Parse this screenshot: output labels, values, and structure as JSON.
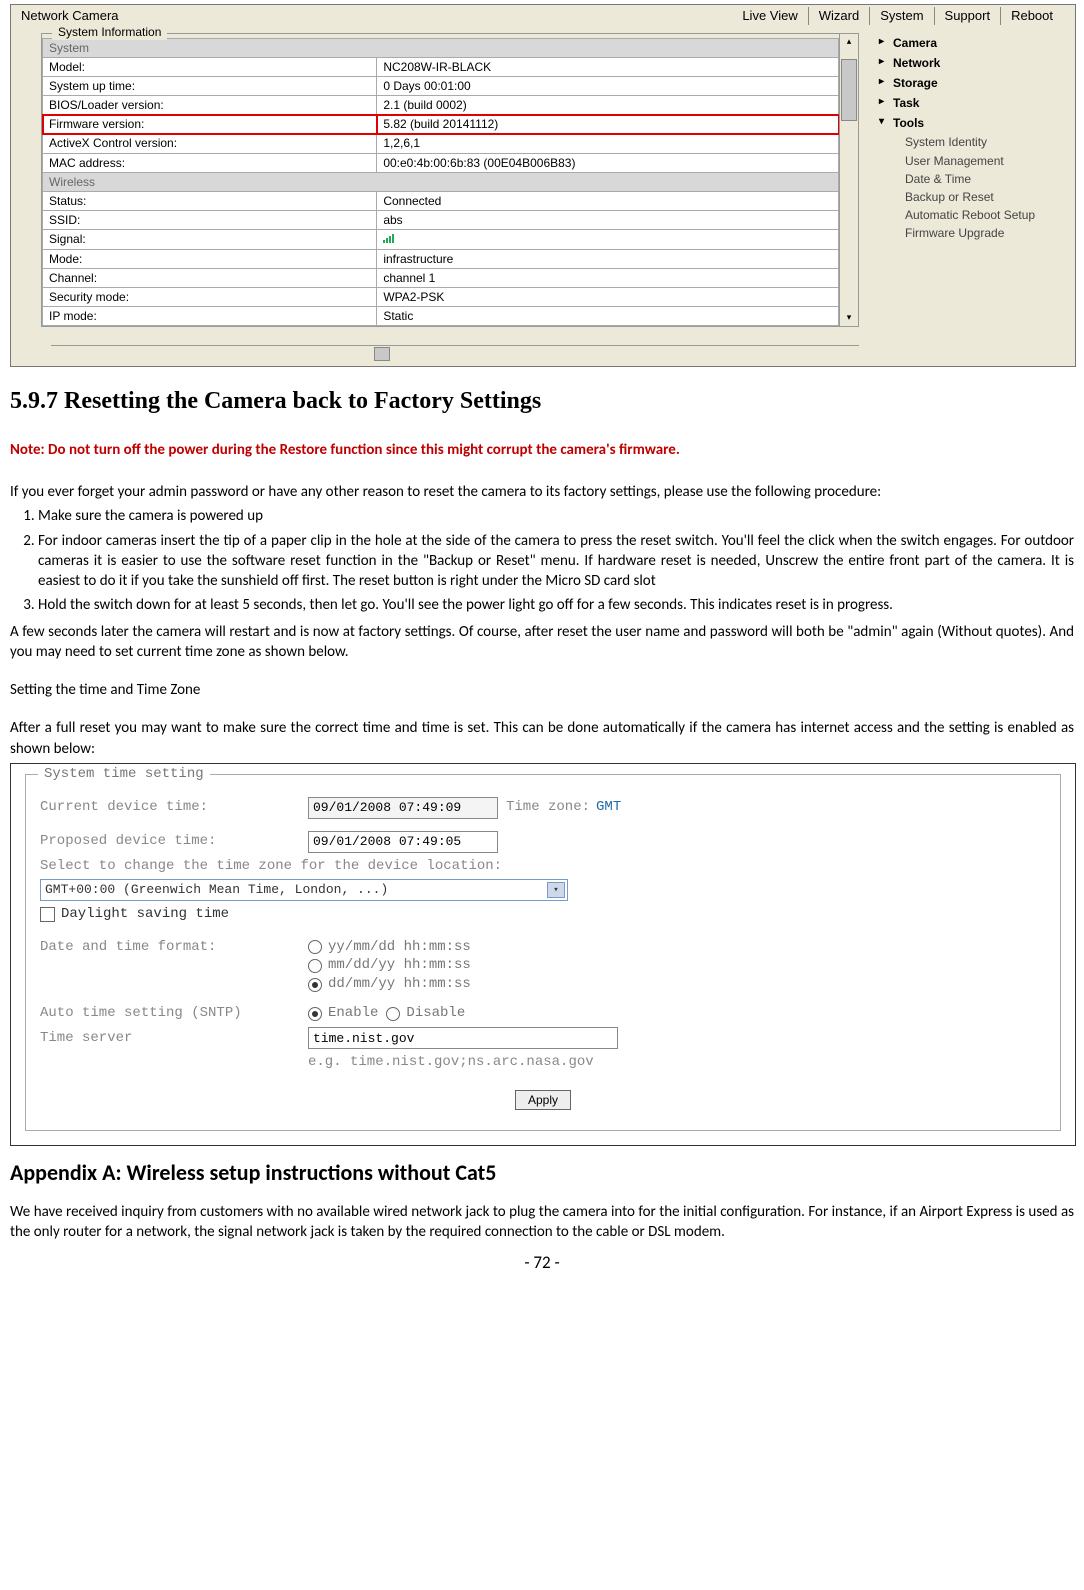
{
  "ss1": {
    "title": "Network Camera",
    "nav": [
      "Live View",
      "Wizard",
      "System",
      "Support",
      "Reboot"
    ],
    "panel_title": "System Information",
    "system_hdr": "System",
    "wireless_hdr": "Wireless",
    "rows_system": [
      {
        "k": "Model:",
        "v": "NC208W-IR-BLACK"
      },
      {
        "k": "System up time:",
        "v": "0 Days 00:01:00"
      },
      {
        "k": "BIOS/Loader version:",
        "v": "2.1 (build 0002)"
      },
      {
        "k": "Firmware version:",
        "v": "5.82 (build 20141112)",
        "hl": true
      },
      {
        "k": "ActiveX Control version:",
        "v": "1,2,6,1"
      },
      {
        "k": "MAC address:",
        "v": "00:e0:4b:00:6b:83 (00E04B006B83)"
      }
    ],
    "rows_wireless": [
      {
        "k": "Status:",
        "v": "Connected"
      },
      {
        "k": "SSID:",
        "v": "abs"
      },
      {
        "k": "Signal:",
        "v": "__SIGNAL__"
      },
      {
        "k": "Mode:",
        "v": "infrastructure"
      },
      {
        "k": "Channel:",
        "v": "channel 1"
      },
      {
        "k": "Security mode:",
        "v": "WPA2-PSK"
      },
      {
        "k": "IP mode:",
        "v": "Static"
      }
    ],
    "sidebar_top": [
      "Camera",
      "Network",
      "Storage",
      "Task",
      "Tools"
    ],
    "sidebar_sub": [
      "System Identity",
      "User Management",
      "Date & Time",
      "Backup or Reset",
      "Automatic Reboot Setup",
      "Firmware Upgrade"
    ]
  },
  "doc": {
    "h597": "5.9.7 Resetting the Camera back to Factory Settings",
    "warn": "Note: Do not turn off the power during the Restore function since this might corrupt the camera's firmware.",
    "intro": "If you ever forget your admin password or have any other reason to reset the camera to its factory settings, please use the following procedure:",
    "step1": "Make sure the camera is powered up",
    "step2": "For indoor cameras insert the tip of a paper clip in the hole at the side of the camera to press the reset switch. You'll feel the click when the switch engages. For outdoor cameras it is easier to use the software reset function in the \"Backup or Reset\" menu. If hardware reset is needed, Unscrew the entire front part of the camera. It is easiest to do it if you take the sunshield off first. The reset button is right under the Micro SD card slot",
    "step3": "Hold the switch down for at least 5 seconds, then let go. You'll see the power light go off for a few seconds. This indicates reset is in progress.",
    "after": "A few seconds later the camera will restart and is now at factory settings. Of course, after reset the user name and password will both be \"admin\" again (Without quotes). And you may need to set current time zone as shown below.",
    "tz_hdr": "Setting the time and Time Zone",
    "tz_body": "After a full reset you may want to make sure the correct time and time is set. This can be done automatically if the camera has internet access and the setting is enabled as shown below:",
    "appendix": "Appendix A: Wireless setup instructions without Cat5",
    "appendix_body": "We have received inquiry from customers with no available wired network jack to plug the camera into for the initial configuration. For instance, if an Airport Express is used as the only router for a network, the signal network jack is taken by the required connection to the cable or DSL modem.",
    "page": "- 72 -"
  },
  "ss2": {
    "legend": "System time setting",
    "cur_lbl": "Current device time:",
    "cur_val": "09/01/2008 07:49:09",
    "tz_lbl": "Time zone:",
    "tz_val": "GMT",
    "prop_lbl": "Proposed device time:",
    "prop_val": "09/01/2008 07:49:05",
    "sel_lbl": "Select to change the time zone for the device location:",
    "sel_val": "GMT+00:00 (Greenwich Mean Time, London, ...)",
    "dst": "Daylight saving time",
    "fmt_lbl": "Date and time format:",
    "fmt1": "yy/mm/dd hh:mm:ss",
    "fmt2": "mm/dd/yy hh:mm:ss",
    "fmt3": "dd/mm/yy hh:mm:ss",
    "sntp_lbl": "Auto time setting (SNTP)",
    "enable": "Enable",
    "disable": "Disable",
    "srv_lbl": "Time server",
    "srv_val": "time.nist.gov",
    "srv_eg": "e.g. time.nist.gov;ns.arc.nasa.gov",
    "apply": "Apply"
  }
}
